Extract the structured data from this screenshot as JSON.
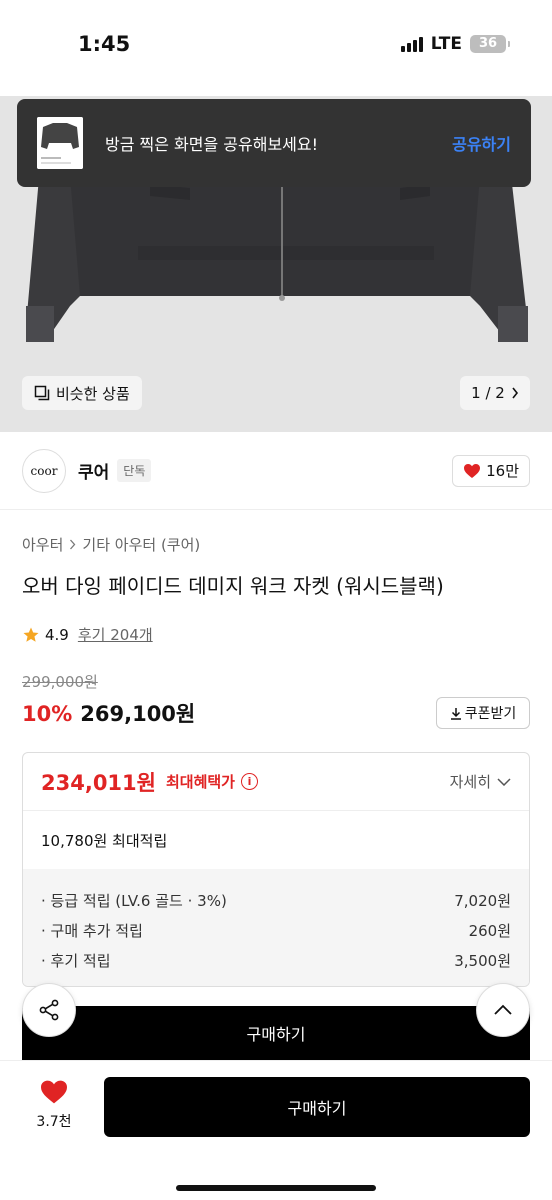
{
  "status_bar": {
    "time": "1:45",
    "network": "LTE",
    "battery": "36"
  },
  "toast": {
    "message": "방금 찍은 화면을 공유해보세요!",
    "action": "공유하기"
  },
  "hero": {
    "similar_label": "비슷한 상품",
    "pager": "1 / 2"
  },
  "brand": {
    "logo_text": "coor",
    "name": "쿠어",
    "badge": "단독",
    "likes": "16만"
  },
  "product": {
    "breadcrumb": [
      "아우터",
      "기타 아우터 (쿠어)"
    ],
    "title": "오버 다잉 페이디드 데미지 워크 자켓 (워시드블랙)",
    "rating": "4.9",
    "reviews": "후기 204개",
    "original_price": "299,000원",
    "discount": "10%",
    "sale_price": "269,100원",
    "coupon_label": "쿠폰받기"
  },
  "benefit": {
    "max_price": "234,011원",
    "max_label": "최대혜택가",
    "detail_label": "자세히",
    "points_summary": "10,780원 최대적립",
    "items": [
      {
        "label": "· 등급 적립 (LV.6 골드 · 3%)",
        "value": "7,020원"
      },
      {
        "label": "· 구매 추가 적립",
        "value": "260원"
      },
      {
        "label": "· 후기 적립",
        "value": "3,500원"
      }
    ]
  },
  "actions": {
    "inline_buy": "구매하기",
    "bottom_likes": "3.7천",
    "bottom_buy": "구매하기"
  },
  "colors": {
    "accent_red": "#e02424",
    "share_blue": "#3b82f6",
    "buy_black": "#000000"
  }
}
